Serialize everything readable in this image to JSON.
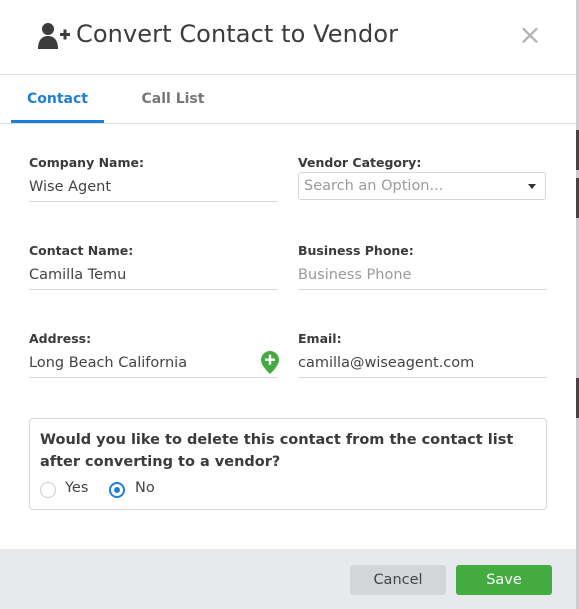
{
  "header": {
    "icon": "add-user-icon",
    "title": "Convert Contact to Vendor",
    "close_icon": "close-icon",
    "close_glyph": "×"
  },
  "tabs": [
    {
      "label": "Contact",
      "active": true
    },
    {
      "label": "Call List",
      "active": false
    }
  ],
  "form": {
    "company_name": {
      "label": "Company Name:",
      "value": "Wise Agent"
    },
    "vendor_category": {
      "label": "Vendor Category:",
      "placeholder": "Search an Option..."
    },
    "contact_name": {
      "label": "Contact Name:",
      "value": "Camilla Temu"
    },
    "business_phone": {
      "label": "Business Phone:",
      "placeholder": "Business Phone"
    },
    "address": {
      "label": "Address:",
      "value": "Long Beach California",
      "icon": "add-location-pin-icon"
    },
    "email": {
      "label": "Email:",
      "value": "camilla@wiseagent.com"
    }
  },
  "delete_question": {
    "text": "Would you like to delete this contact from the contact list after converting to a vendor?",
    "options": [
      {
        "label": "Yes",
        "selected": false
      },
      {
        "label": "No",
        "selected": true
      }
    ]
  },
  "footer": {
    "cancel_label": "Cancel",
    "save_label": "Save"
  },
  "colors": {
    "accent": "#1f7fd8",
    "save": "#43ab3f",
    "footer_bg": "#e7eaed"
  }
}
